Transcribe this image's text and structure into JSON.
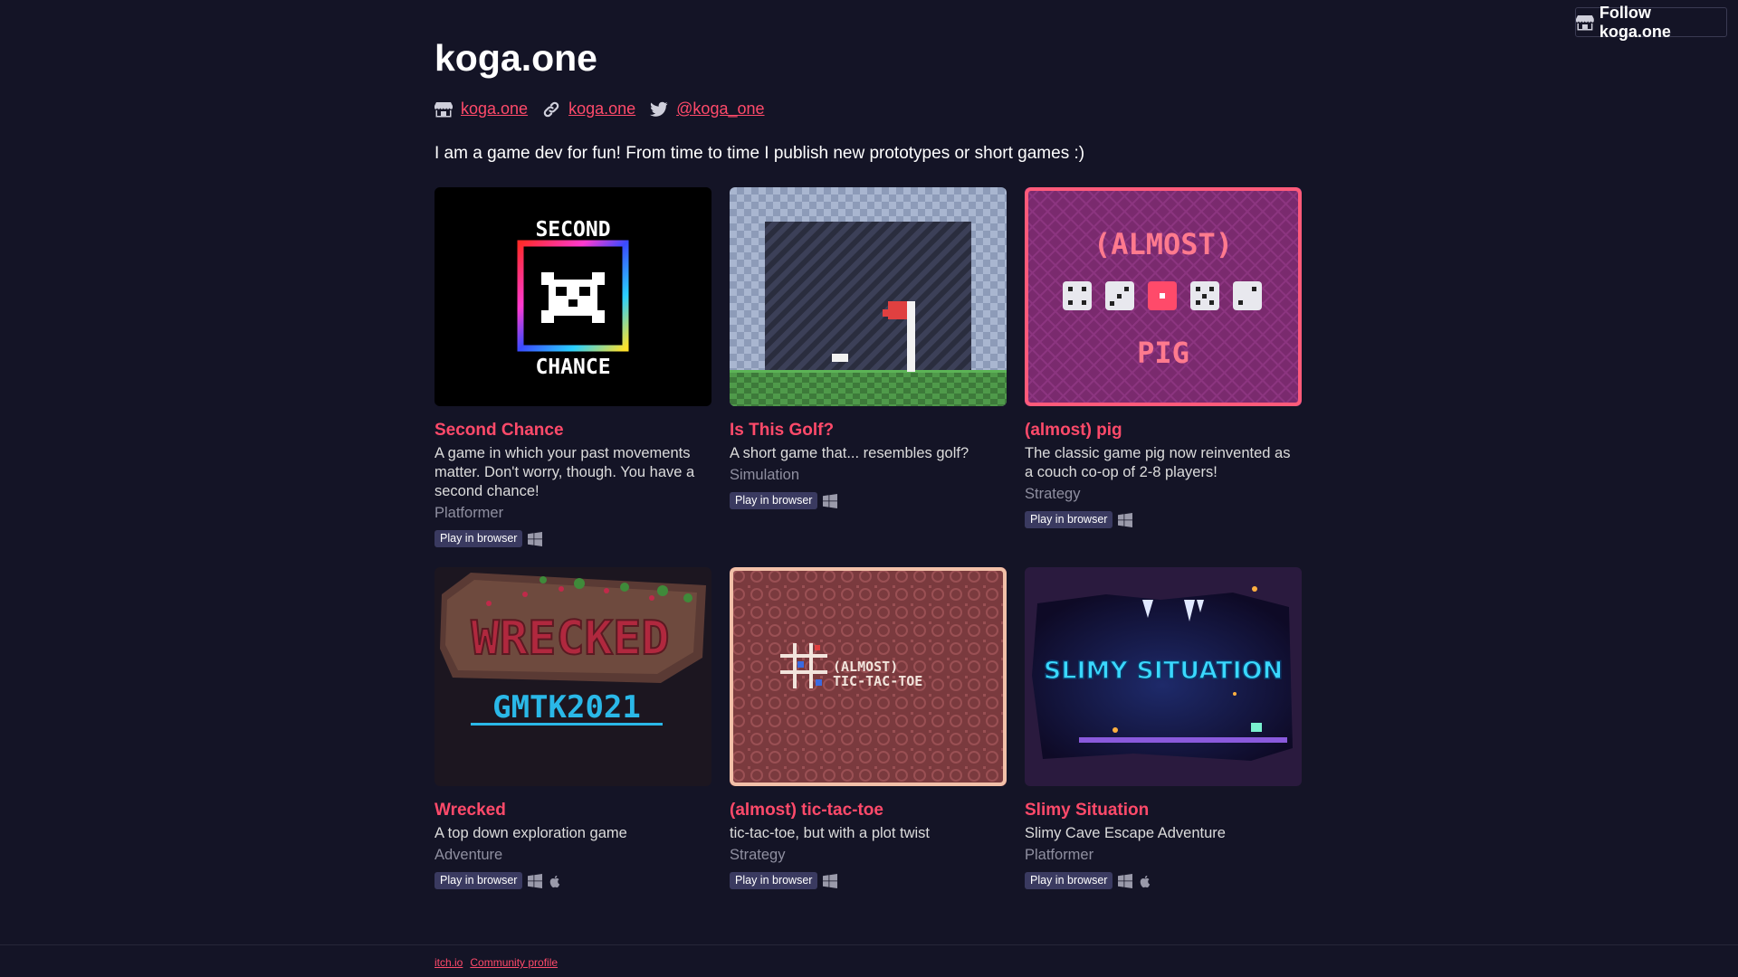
{
  "follow_button": {
    "label": "Follow koga.one"
  },
  "profile": {
    "title": "koga.one",
    "links": [
      {
        "icon": "store-icon",
        "text": "koga.one"
      },
      {
        "icon": "link-icon",
        "text": "koga.one"
      },
      {
        "icon": "twitter-icon",
        "text": "@koga_one"
      }
    ],
    "description": "I am a game dev for fun! From time to time I publish new prototypes or short games :)"
  },
  "games": [
    {
      "title": "Second Chance",
      "description": "A game in which your past movements matter. Don't worry, though. You have a second chance!",
      "genre": "Platformer",
      "badge": "Play in browser",
      "platforms": [
        "windows-icon"
      ],
      "cover_text_top": "SECOND",
      "cover_text_bottom": "CHANCE"
    },
    {
      "title": "Is This Golf?",
      "description": "A short game that... resembles golf?",
      "genre": "Simulation",
      "badge": "Play in browser",
      "platforms": [
        "windows-icon"
      ]
    },
    {
      "title": "(almost) pig",
      "description": "The classic game pig now reinvented as a couch co-op of 2-8 players!",
      "genre": "Strategy",
      "badge": "Play in browser",
      "platforms": [
        "windows-icon"
      ],
      "cover_text_top": "(ALMOST)",
      "cover_text_bottom": "PIG"
    },
    {
      "title": "Wrecked",
      "description": "A top down exploration game",
      "genre": "Adventure",
      "badge": "Play in browser",
      "platforms": [
        "windows-icon",
        "apple-icon"
      ],
      "cover_text_top": "WRECKED",
      "cover_text_bottom": "GMTK2021"
    },
    {
      "title": "(almost) tic-tac-toe",
      "description": "tic-tac-toe, but with a plot twist",
      "genre": "Strategy",
      "badge": "Play in browser",
      "platforms": [
        "windows-icon"
      ],
      "cover_text_top": "(ALMOST)",
      "cover_text_bottom": "TIC-TAC-TOE"
    },
    {
      "title": "Slimy Situation",
      "description": "Slimy Cave Escape Adventure",
      "genre": "Platformer",
      "badge": "Play in browser",
      "platforms": [
        "windows-icon",
        "apple-icon"
      ],
      "cover_text_top": "SLIMY SITUATION"
    }
  ],
  "footer": {
    "links": [
      "itch.io",
      "Community profile"
    ]
  },
  "colors": {
    "background": "#141426",
    "accent": "#ff4a6a",
    "text": "#ffffff",
    "muted": "#8f8fa0",
    "badge": "#3a3a60"
  }
}
